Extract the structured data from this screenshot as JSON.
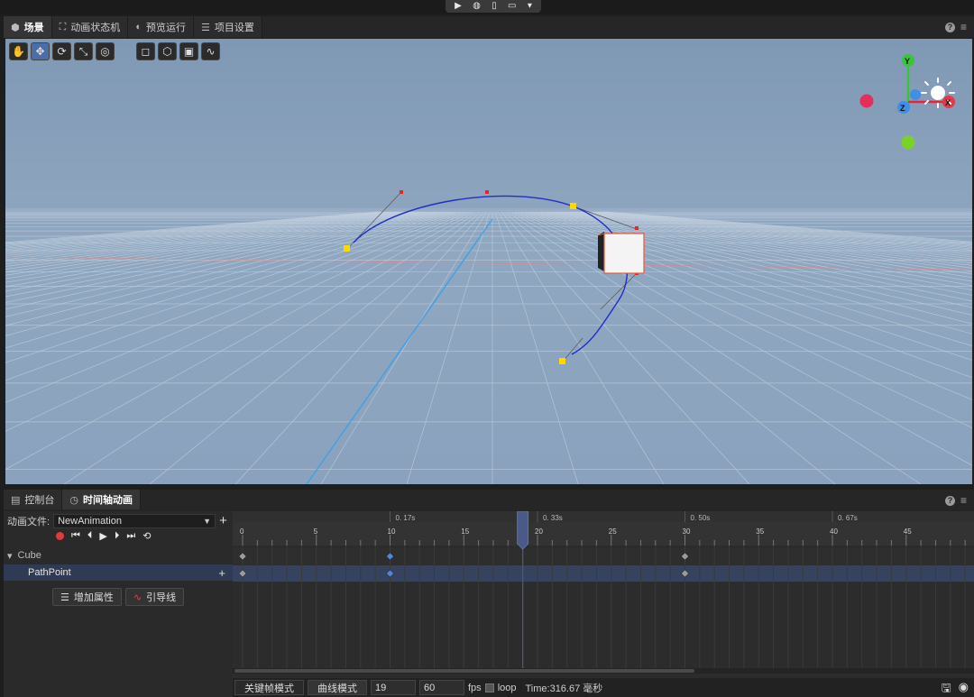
{
  "topbar": {
    "icons": [
      "play-icon",
      "globe-icon",
      "phone-icon",
      "monitor-icon",
      "dropdown-icon"
    ]
  },
  "scene_tabs": [
    {
      "label": "场景",
      "icon": "cube-icon",
      "active": true
    },
    {
      "label": "动画状态机",
      "icon": "state-machine-icon",
      "active": false
    },
    {
      "label": "预览运行",
      "icon": "preview-icon",
      "active": false
    },
    {
      "label": "项目设置",
      "icon": "settings-sliders-icon",
      "active": false
    }
  ],
  "gizmo": {
    "y": "Y",
    "x": "X",
    "z": "Z"
  },
  "bottom_tabs": [
    {
      "label": "控制台",
      "icon": "console-icon",
      "active": false
    },
    {
      "label": "时间轴动画",
      "icon": "clock-icon",
      "active": true
    }
  ],
  "animation": {
    "file_label": "动画文件:",
    "file_value": "NewAnimation",
    "node": "Cube",
    "property": "PathPoint",
    "add_property": "增加属性",
    "guide_line": "引导线"
  },
  "timeline": {
    "time_markers": [
      "0. 17s",
      "0. 33s",
      "0. 50s",
      "0. 67s"
    ],
    "frame_ticks": [
      "0",
      "5",
      "10",
      "15",
      "20",
      "25",
      "30",
      "35",
      "40",
      "45"
    ],
    "current_frame": 19,
    "keyframes": [
      0,
      10,
      30
    ]
  },
  "footer": {
    "keyframe_mode": "关键帧模式",
    "curve_mode": "曲线模式",
    "frame_value": "19",
    "fps_value": "60",
    "fps_label": "fps",
    "loop_label": "loop",
    "time_text": "Time:316.67 毫秒"
  },
  "colors": {
    "accent": "#4a6ea8",
    "record": "#e53a3a",
    "path": "#1f2fc8",
    "handle": "#ffd800"
  }
}
